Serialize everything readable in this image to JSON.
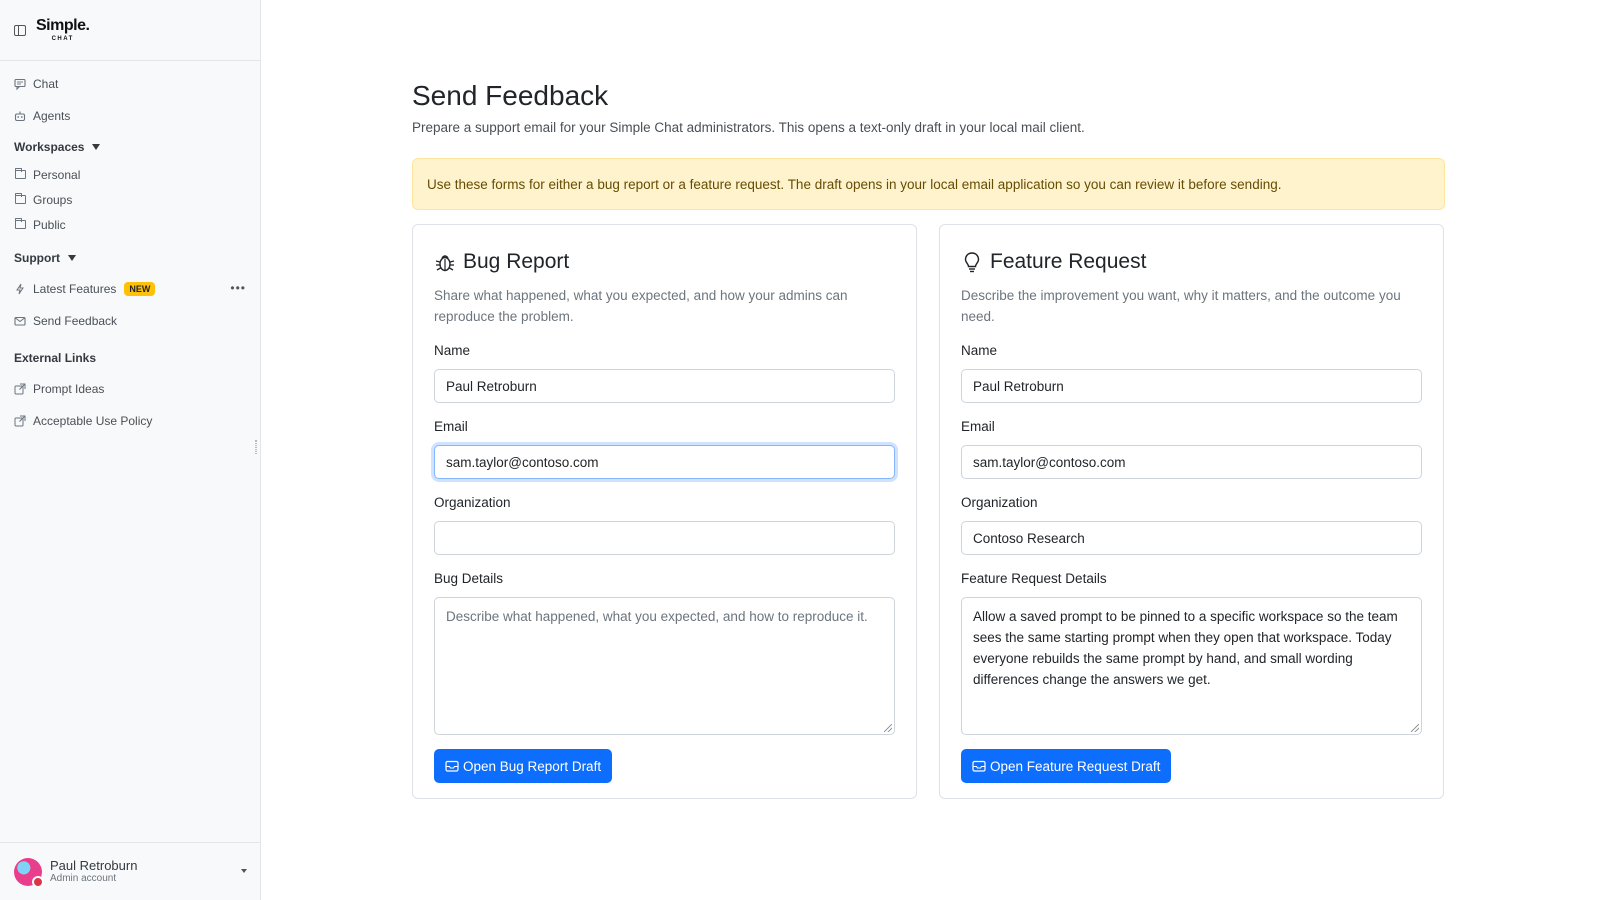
{
  "app": {
    "logo_main": "Simple.",
    "logo_sub": "CHAT"
  },
  "sidebar": {
    "chat": "Chat",
    "agents": "Agents",
    "workspaces": "Workspaces",
    "workspace_items": [
      "Personal",
      "Groups",
      "Public"
    ],
    "support": "Support",
    "latest_features": "Latest Features",
    "new_badge": "NEW",
    "send_feedback": "Send Feedback",
    "external_links": "External Links",
    "prompt_ideas": "Prompt Ideas",
    "acceptable_use": "Acceptable Use Policy",
    "user_name": "Paul Retroburn",
    "user_role": "Admin account"
  },
  "page": {
    "title": "Send Feedback",
    "subtitle": "Prepare a support email for your Simple Chat administrators. This opens a text-only draft in your local mail client.",
    "alert": "Use these forms for either a bug report or a feature request. The draft opens in your local email application so you can review it before sending."
  },
  "bug_report": {
    "title": "Bug Report",
    "description": "Share what happened, what you expected, and how your admins can reproduce the problem.",
    "name_label": "Name",
    "name_value": "Paul Retroburn",
    "email_label": "Email",
    "email_value": "sam.taylor@contoso.com",
    "org_label": "Organization",
    "org_value": "",
    "details_label": "Bug Details",
    "details_placeholder": "Describe what happened, what you expected, and how to reproduce it.",
    "button": "Open Bug Report Draft"
  },
  "feature_request": {
    "title": "Feature Request",
    "description": "Describe the improvement you want, why it matters, and the outcome you need.",
    "name_label": "Name",
    "name_value": "Paul Retroburn",
    "email_label": "Email",
    "email_value": "sam.taylor@contoso.com",
    "org_label": "Organization",
    "org_value": "Contoso Research",
    "details_label": "Feature Request Details",
    "details_value": "Allow a saved prompt to be pinned to a specific workspace so the team sees the same starting prompt when they open that workspace. Today everyone rebuilds the same prompt by hand, and small wording differences change the answers we get.",
    "button": "Open Feature Request Draft"
  },
  "colors": {
    "primary": "#0d6efd",
    "alert_bg": "#fff3cd",
    "badge": "#ffc107"
  }
}
